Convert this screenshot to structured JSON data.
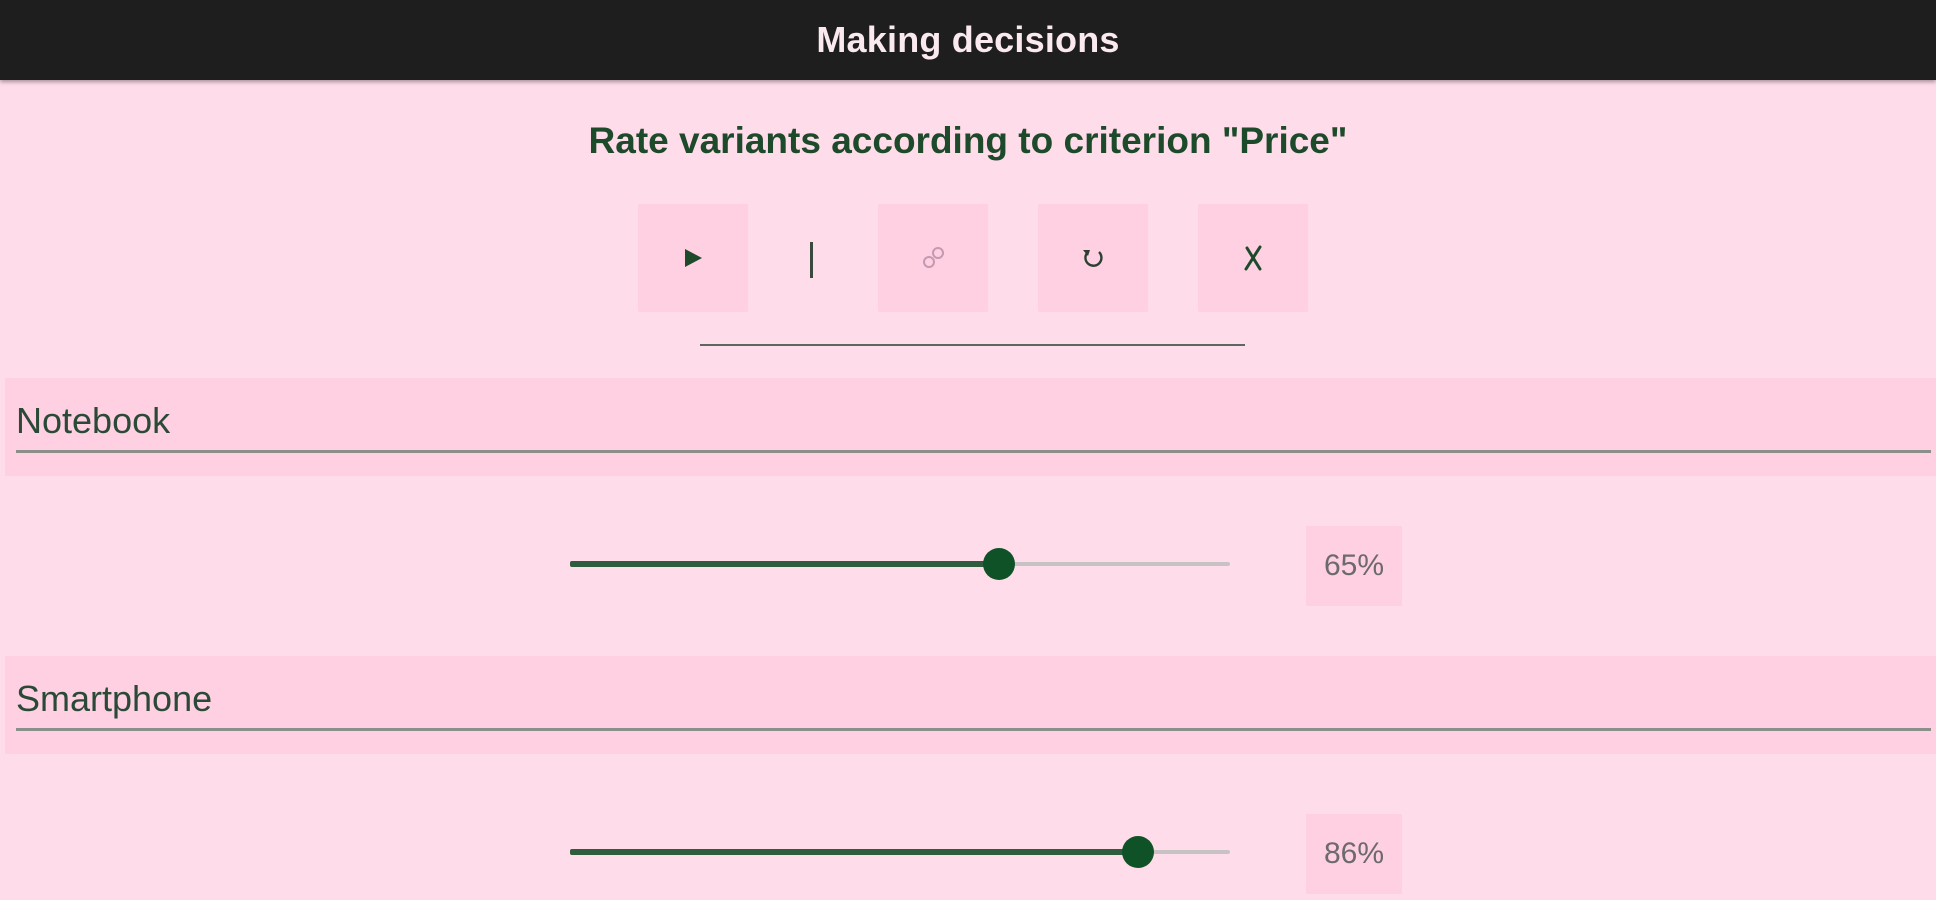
{
  "appbar": {
    "title": "Making decisions"
  },
  "instruction": "Rate variants according to criterion \"Price\"",
  "toolbar": {
    "buttons": [
      {
        "name": "play-icon",
        "glyph": "▶"
      },
      {
        "name": "link-icon",
        "glyph": "☍"
      },
      {
        "name": "refresh-icon",
        "glyph": "↻"
      },
      {
        "name": "close-icon",
        "glyph": "✗"
      }
    ]
  },
  "variants": [
    {
      "label": "Notebook",
      "value": 65,
      "value_text": "65%"
    },
    {
      "label": "Smartphone",
      "value": 86,
      "value_text": "86%"
    }
  ],
  "colors": {
    "background": "#ffdcea",
    "appbar": "#1e1e1e",
    "accent": "#0f5228",
    "text": "#1d4a2b"
  }
}
